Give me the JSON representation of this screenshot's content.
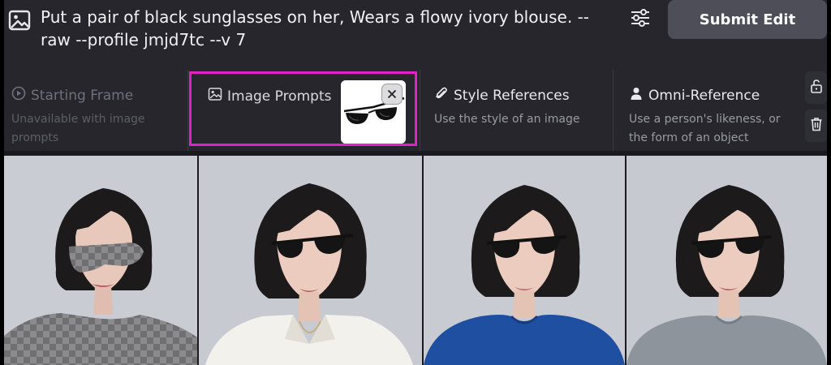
{
  "prompt": {
    "text": "Put a pair of black sunglasses on her, Wears a flowy ivory blouse. --raw --profile jmjd7tc --v 7",
    "submit_label": "Submit Edit"
  },
  "references": {
    "starting_frame": {
      "title": "Starting Frame",
      "description": "Unavailable with image prompts"
    },
    "image_prompts": {
      "title": "Image Prompts"
    },
    "style_references": {
      "title": "Style References",
      "description": "Use the style of an image"
    },
    "omni_reference": {
      "title": "Omni-Reference",
      "description": "Use a person's likeness, or the form of an object"
    }
  },
  "colors": {
    "highlight": "#e321c6",
    "panel": "#26262c",
    "submit": "#4e4e58"
  },
  "icons": [
    "image-icon",
    "sliders-icon",
    "play-circle-icon",
    "image-prompt-icon",
    "paperclip-icon",
    "person-icon",
    "close-icon",
    "unlock-icon",
    "trash-icon"
  ],
  "gallery": [
    {
      "shirt": "erased"
    },
    {
      "shirt": "white blouse"
    },
    {
      "shirt": "blue top"
    },
    {
      "shirt": "grey top"
    }
  ]
}
